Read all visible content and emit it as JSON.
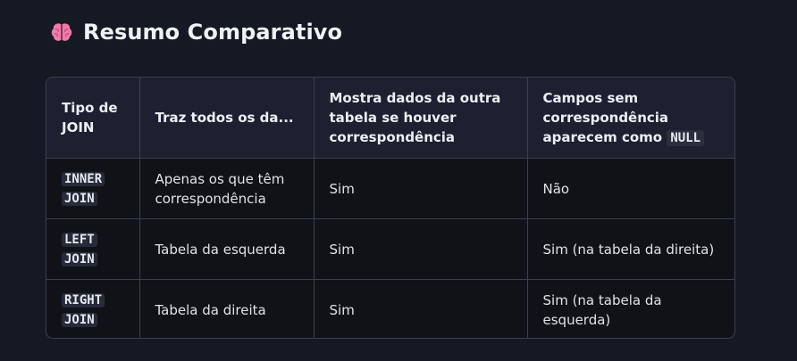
{
  "heading": {
    "icon": "brain-icon",
    "title": "Resumo Comparativo"
  },
  "table": {
    "headers": {
      "col1": "Tipo de JOIN",
      "col2": "Traz todos os da...",
      "col3": "Mostra dados da outra tabela se houver correspondência",
      "col4_text": "Campos sem correspondência aparecem como",
      "col4_code": "NULL"
    },
    "rows": [
      {
        "join_line1": "INNER",
        "join_line2": "JOIN",
        "brings": "Apenas os que têm correspondência",
        "shows": "Sim",
        "null_fields": "Não"
      },
      {
        "join_line1": "LEFT",
        "join_line2": "JOIN",
        "brings": "Tabela da esquerda",
        "shows": "Sim",
        "null_fields": "Sim (na tabela da direita)"
      },
      {
        "join_line1": "RIGHT",
        "join_line2": "JOIN",
        "brings": "Tabela da direita",
        "shows": "Sim",
        "null_fields": "Sim (na tabela da esquerda)"
      }
    ]
  }
}
